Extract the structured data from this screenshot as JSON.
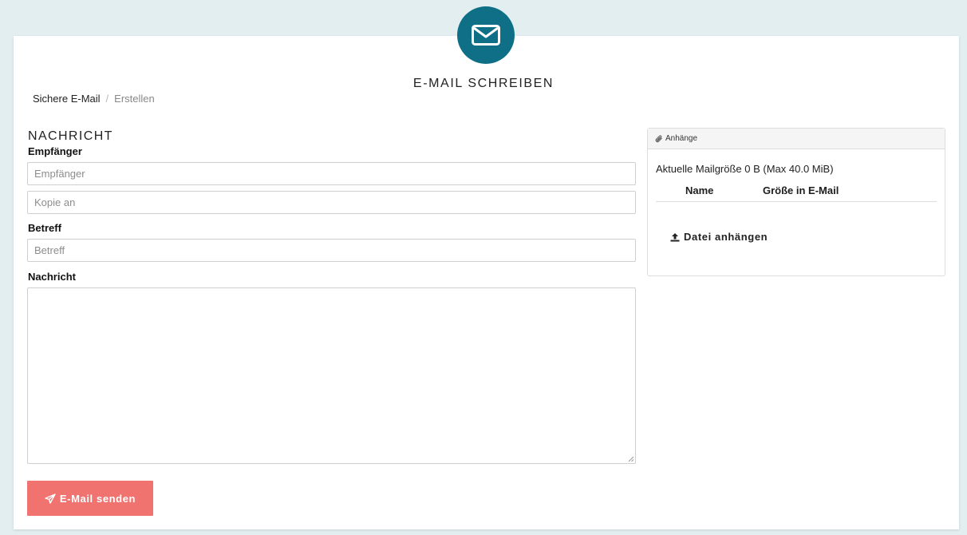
{
  "header": {
    "title": "E-MAIL SCHREIBEN",
    "icon": "envelope-icon",
    "accent_color": "#0e6f86"
  },
  "breadcrumb": {
    "parent": "Sichere E-Mail",
    "separator": "/",
    "current": "Erstellen"
  },
  "form": {
    "section_title": "NACHRICHT",
    "recipient_label": "Empfänger",
    "recipient_placeholder": "Empfänger",
    "cc_placeholder": "Kopie an",
    "subject_label": "Betreff",
    "subject_placeholder": "Betreff",
    "message_label": "Nachricht",
    "message_value": "",
    "send_label": "E-Mail senden",
    "send_icon": "paper-plane-icon",
    "send_color": "#f07370"
  },
  "attachments": {
    "header_label": "Anhänge",
    "header_icon": "paperclip-icon",
    "size_info": "Aktuelle Mailgröße 0 B (Max 40.0 MiB)",
    "columns": [
      "Name",
      "Größe in E-Mail"
    ],
    "rows": [],
    "attach_label": "Datei anhängen",
    "attach_icon": "upload-icon"
  }
}
